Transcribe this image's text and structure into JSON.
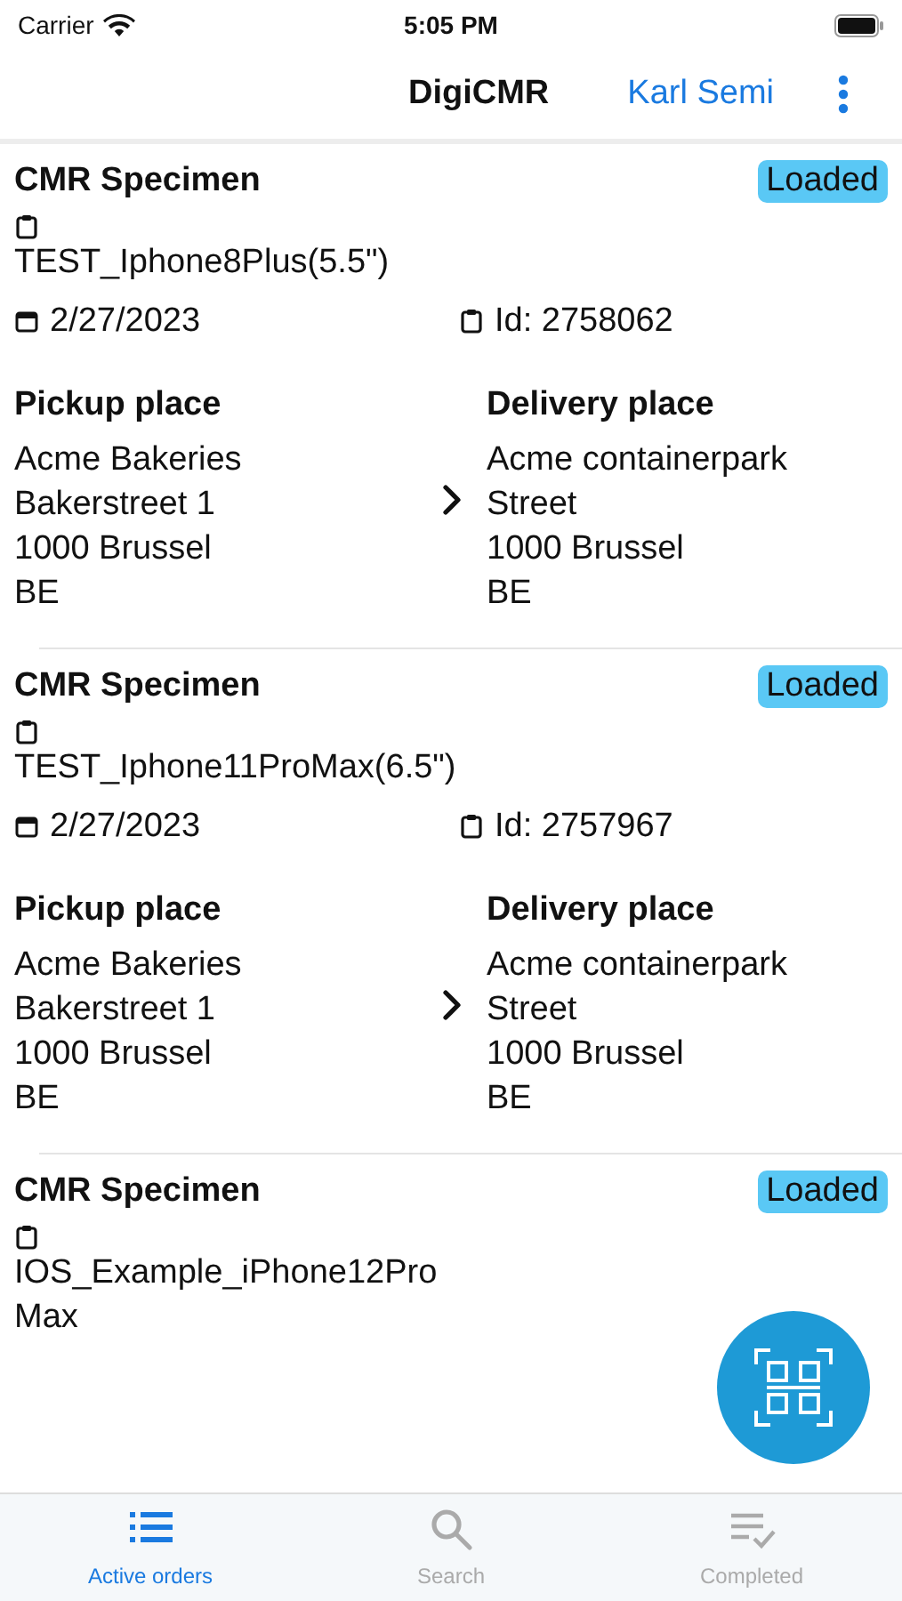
{
  "status_bar": {
    "carrier": "Carrier",
    "time": "5:05 PM"
  },
  "nav_bar": {
    "title": "DigiCMR",
    "user": "Karl Semi"
  },
  "orders": [
    {
      "title": "CMR Specimen",
      "status": "Loaded",
      "reference": "TEST_Iphone8Plus(5.5\")",
      "date": "2/27/2023",
      "id": "Id: 2758062",
      "pickup": {
        "heading": "Pickup place",
        "lines": [
          "Acme Bakeries",
          "Bakerstreet 1",
          "1000 Brussel",
          "BE"
        ]
      },
      "delivery": {
        "heading": "Delivery place",
        "lines": [
          "Acme containerpark",
          "Street",
          "1000 Brussel",
          "BE"
        ]
      }
    },
    {
      "title": "CMR Specimen",
      "status": "Loaded",
      "reference": "TEST_Iphone11ProMax(6.5\")",
      "date": "2/27/2023",
      "id": "Id: 2757967",
      "pickup": {
        "heading": "Pickup place",
        "lines": [
          "Acme Bakeries",
          "Bakerstreet 1",
          "1000 Brussel",
          "BE"
        ]
      },
      "delivery": {
        "heading": "Delivery place",
        "lines": [
          "Acme containerpark",
          "Street",
          "1000 Brussel",
          "BE"
        ]
      }
    },
    {
      "title": "CMR Specimen",
      "status": "Loaded",
      "reference": "IOS_Example_iPhone12ProMax"
    }
  ],
  "tabs": [
    {
      "label": "Active orders",
      "kind": "list",
      "selected": true
    },
    {
      "label": "Search",
      "kind": "search",
      "selected": false
    },
    {
      "label": "Completed",
      "kind": "completed",
      "selected": false
    }
  ]
}
